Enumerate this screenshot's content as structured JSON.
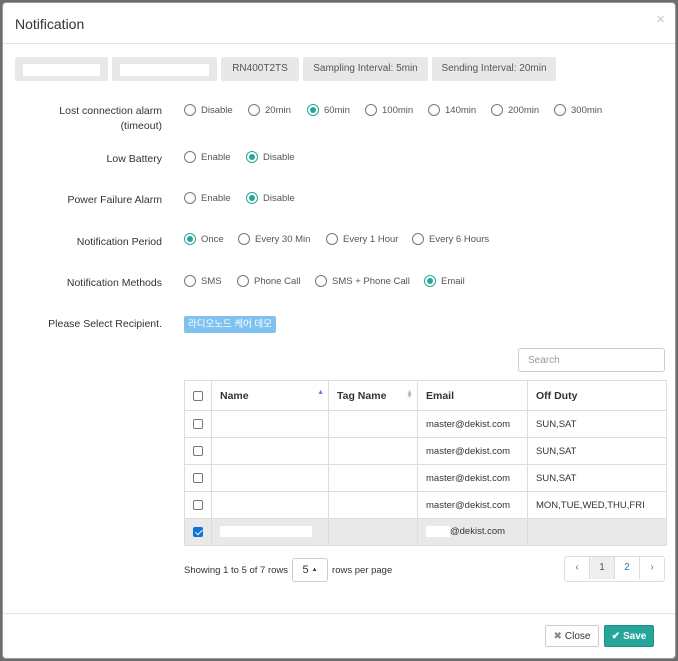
{
  "modal": {
    "title": "Notification",
    "close_symbol": "×"
  },
  "tags": [
    "",
    "",
    "RN400T2TS",
    "Sampling Interval: 5min",
    "Sending Interval: 20min"
  ],
  "form": {
    "lost_connection": {
      "label": "Lost connection alarm",
      "label2": "(timeout)",
      "options": [
        "Disable",
        "20min",
        "60min",
        "100min",
        "140min",
        "200min",
        "300min"
      ],
      "selected": "60min"
    },
    "low_battery": {
      "label": "Low Battery",
      "options": [
        "Enable",
        "Disable"
      ],
      "selected": "Disable"
    },
    "power_failure": {
      "label": "Power Failure Alarm",
      "options": [
        "Enable",
        "Disable"
      ],
      "selected": "Disable"
    },
    "notification_period": {
      "label": "Notification Period",
      "options": [
        "Once",
        "Every 30 Min",
        "Every 1 Hour",
        "Every 6 Hours"
      ],
      "selected": "Once"
    },
    "notification_methods": {
      "label": "Notification Methods",
      "options": [
        "SMS",
        "Phone Call",
        "SMS + Phone Call",
        "Email"
      ],
      "selected": "Email"
    },
    "recipient": {
      "label": "Please Select Recipient.",
      "badge": "라디오노드 케어 데모"
    }
  },
  "table": {
    "search_placeholder": "Search",
    "columns": [
      "Name",
      "Tag Name",
      "Email",
      "Off Duty"
    ],
    "rows": [
      {
        "checked": false,
        "name": "",
        "tag": "",
        "email": "master@dekist.com",
        "off_duty": "SUN,SAT"
      },
      {
        "checked": false,
        "name": "",
        "tag": "",
        "email": "master@dekist.com",
        "off_duty": "SUN,SAT"
      },
      {
        "checked": false,
        "name": "",
        "tag": "",
        "email": "master@dekist.com",
        "off_duty": "SUN,SAT"
      },
      {
        "checked": false,
        "name": "",
        "tag": "",
        "email": "master@dekist.com",
        "off_duty": "MON,TUE,WED,THU,FRI"
      },
      {
        "checked": true,
        "name": "",
        "tag": "",
        "email": "@dekist.com",
        "off_duty": ""
      }
    ]
  },
  "pagination": {
    "showing": "Showing 1 to 5 of 7 rows",
    "page_size": "5",
    "rows_per_page": "rows per page",
    "prev": "‹",
    "pages": [
      "1",
      "2"
    ],
    "active": "1",
    "next": "›"
  },
  "footer": {
    "close": "Close",
    "save": "Save",
    "close_icon": "x-icon",
    "save_icon": "check-icon"
  },
  "colors": {
    "accent": "#26a69a",
    "badge": "#7fc1ef",
    "checkbox": "#0e72d8"
  }
}
